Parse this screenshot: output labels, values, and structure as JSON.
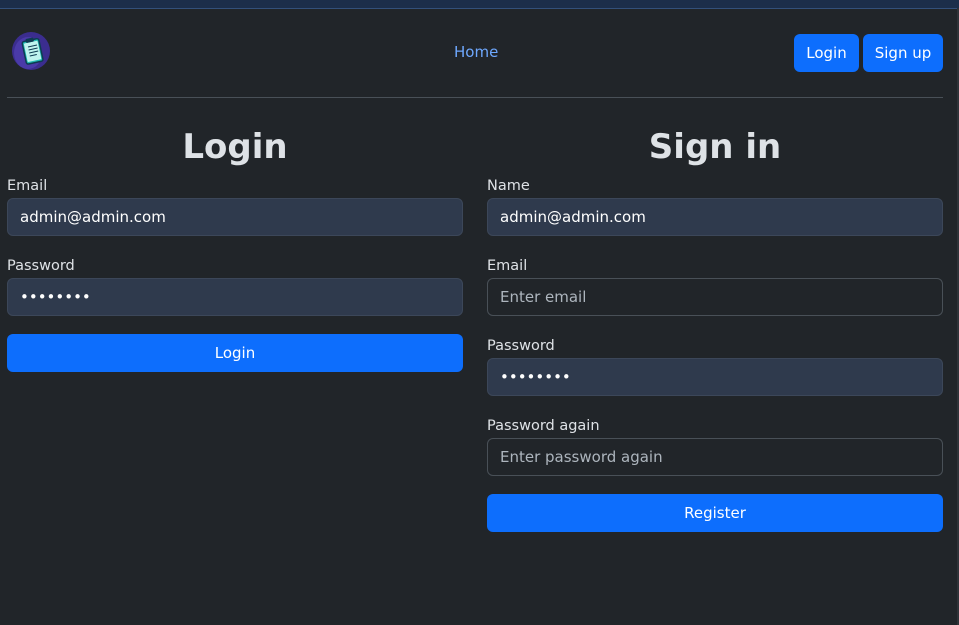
{
  "nav": {
    "home_label": "Home",
    "login_label": "Login",
    "signup_label": "Sign up",
    "logo_icon": "clipboard-icon"
  },
  "login_form": {
    "title": "Login",
    "email_label": "Email",
    "email_value": "admin@admin.com",
    "password_label": "Password",
    "password_value": "password",
    "submit_label": "Login"
  },
  "signup_form": {
    "title": "Sign in",
    "name_label": "Name",
    "name_value": "admin@admin.com",
    "email_label": "Email",
    "email_placeholder": "Enter email",
    "password_label": "Password",
    "password_value": "password",
    "password_again_label": "Password again",
    "password_again_placeholder": "Enter password again",
    "submit_label": "Register"
  },
  "colors": {
    "background": "#212529",
    "primary": "#0d6efd",
    "link": "#6ea8fe"
  }
}
